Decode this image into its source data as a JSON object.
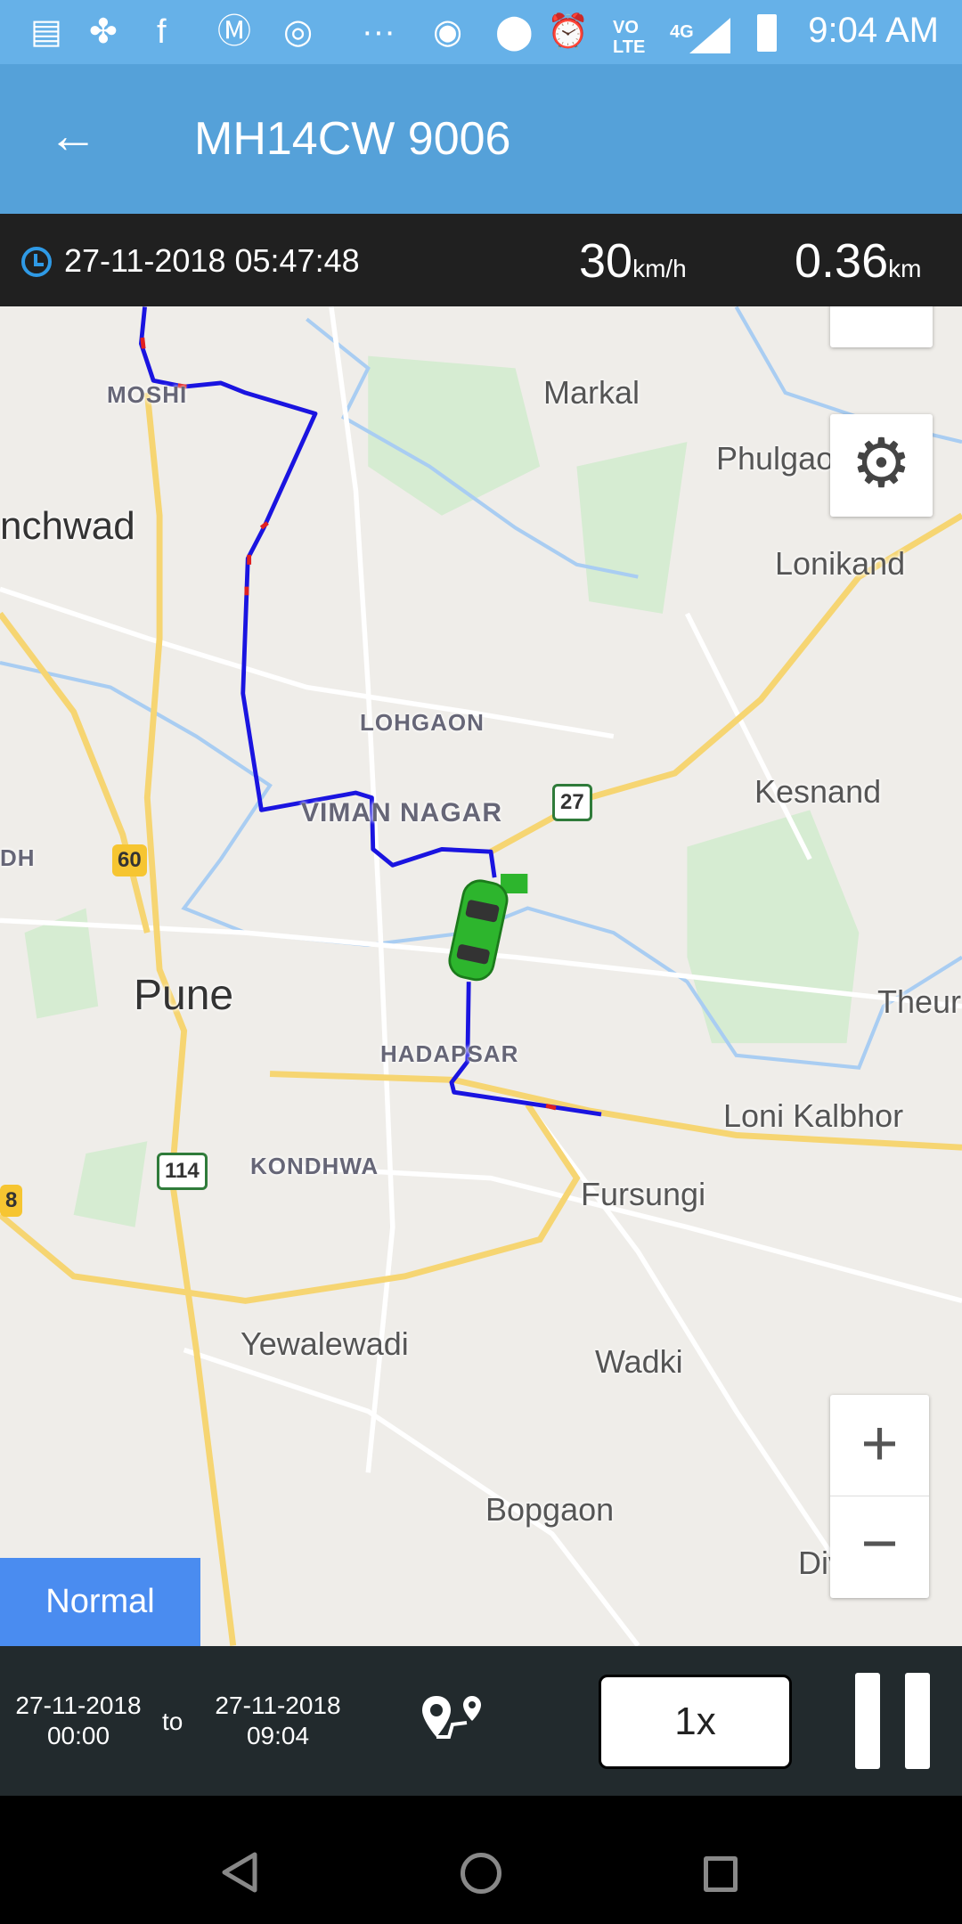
{
  "status_bar": {
    "time": "9:04 AM",
    "icons": [
      "notes-icon",
      "fan-app-icon",
      "facebook-icon",
      "m-app-icon",
      "chrome-icon",
      "more-icon",
      "hotspot-icon",
      "location-icon",
      "alarm-icon",
      "volte-icon",
      "data-4g-icon",
      "signal-icon",
      "battery-icon"
    ],
    "overflow": "···",
    "network": "4G",
    "volte": "LTE"
  },
  "app_bar": {
    "title": "MH14CW 9006",
    "back_icon": "arrow-left-icon"
  },
  "info_bar": {
    "datetime": "27-11-2018 05:47:48",
    "speed": "30",
    "speed_unit": "km/h",
    "distance": "0.36",
    "distance_unit": "km"
  },
  "map": {
    "labels": {
      "markal": "Markal",
      "moshi": "MOSHI",
      "phulgaon": "Phulgao",
      "chinchwad": "nchwad",
      "lonikand": "Lonikand",
      "lohgaon": "LOHGAON",
      "viman_nagar": "VIMAN NAGAR",
      "kesnand": "Kesnand",
      "dh": "DH",
      "pune": "Pune",
      "theur": "Theur",
      "hadapsar": "HADAPSAR",
      "loni_kalbhor": "Loni Kalbhor",
      "kondhwa": "KONDHWA",
      "fursungi": "Fursungi",
      "yewalewadi": "Yewalewadi",
      "wadki": "Wadki",
      "bopgaon": "Bopgaon",
      "dive": "Dive"
    },
    "shields": {
      "nh60": "60",
      "nh27": "27",
      "nh114": "114",
      "nh48": "8"
    },
    "route_color": "#1a14e0",
    "overspeed_color": "#e02020",
    "vehicle_color": "#2db52d",
    "map_type": "Normal",
    "zoom_in": "+",
    "zoom_out": "−"
  },
  "bottom_bar": {
    "from_date": "27-11-2018",
    "from_time": "00:00",
    "to_label": "to",
    "to_date": "27-11-2018",
    "to_time": "09:04",
    "playback_speed": "1x",
    "route_icon": "route-icon",
    "pause_icon": "pause-icon"
  }
}
